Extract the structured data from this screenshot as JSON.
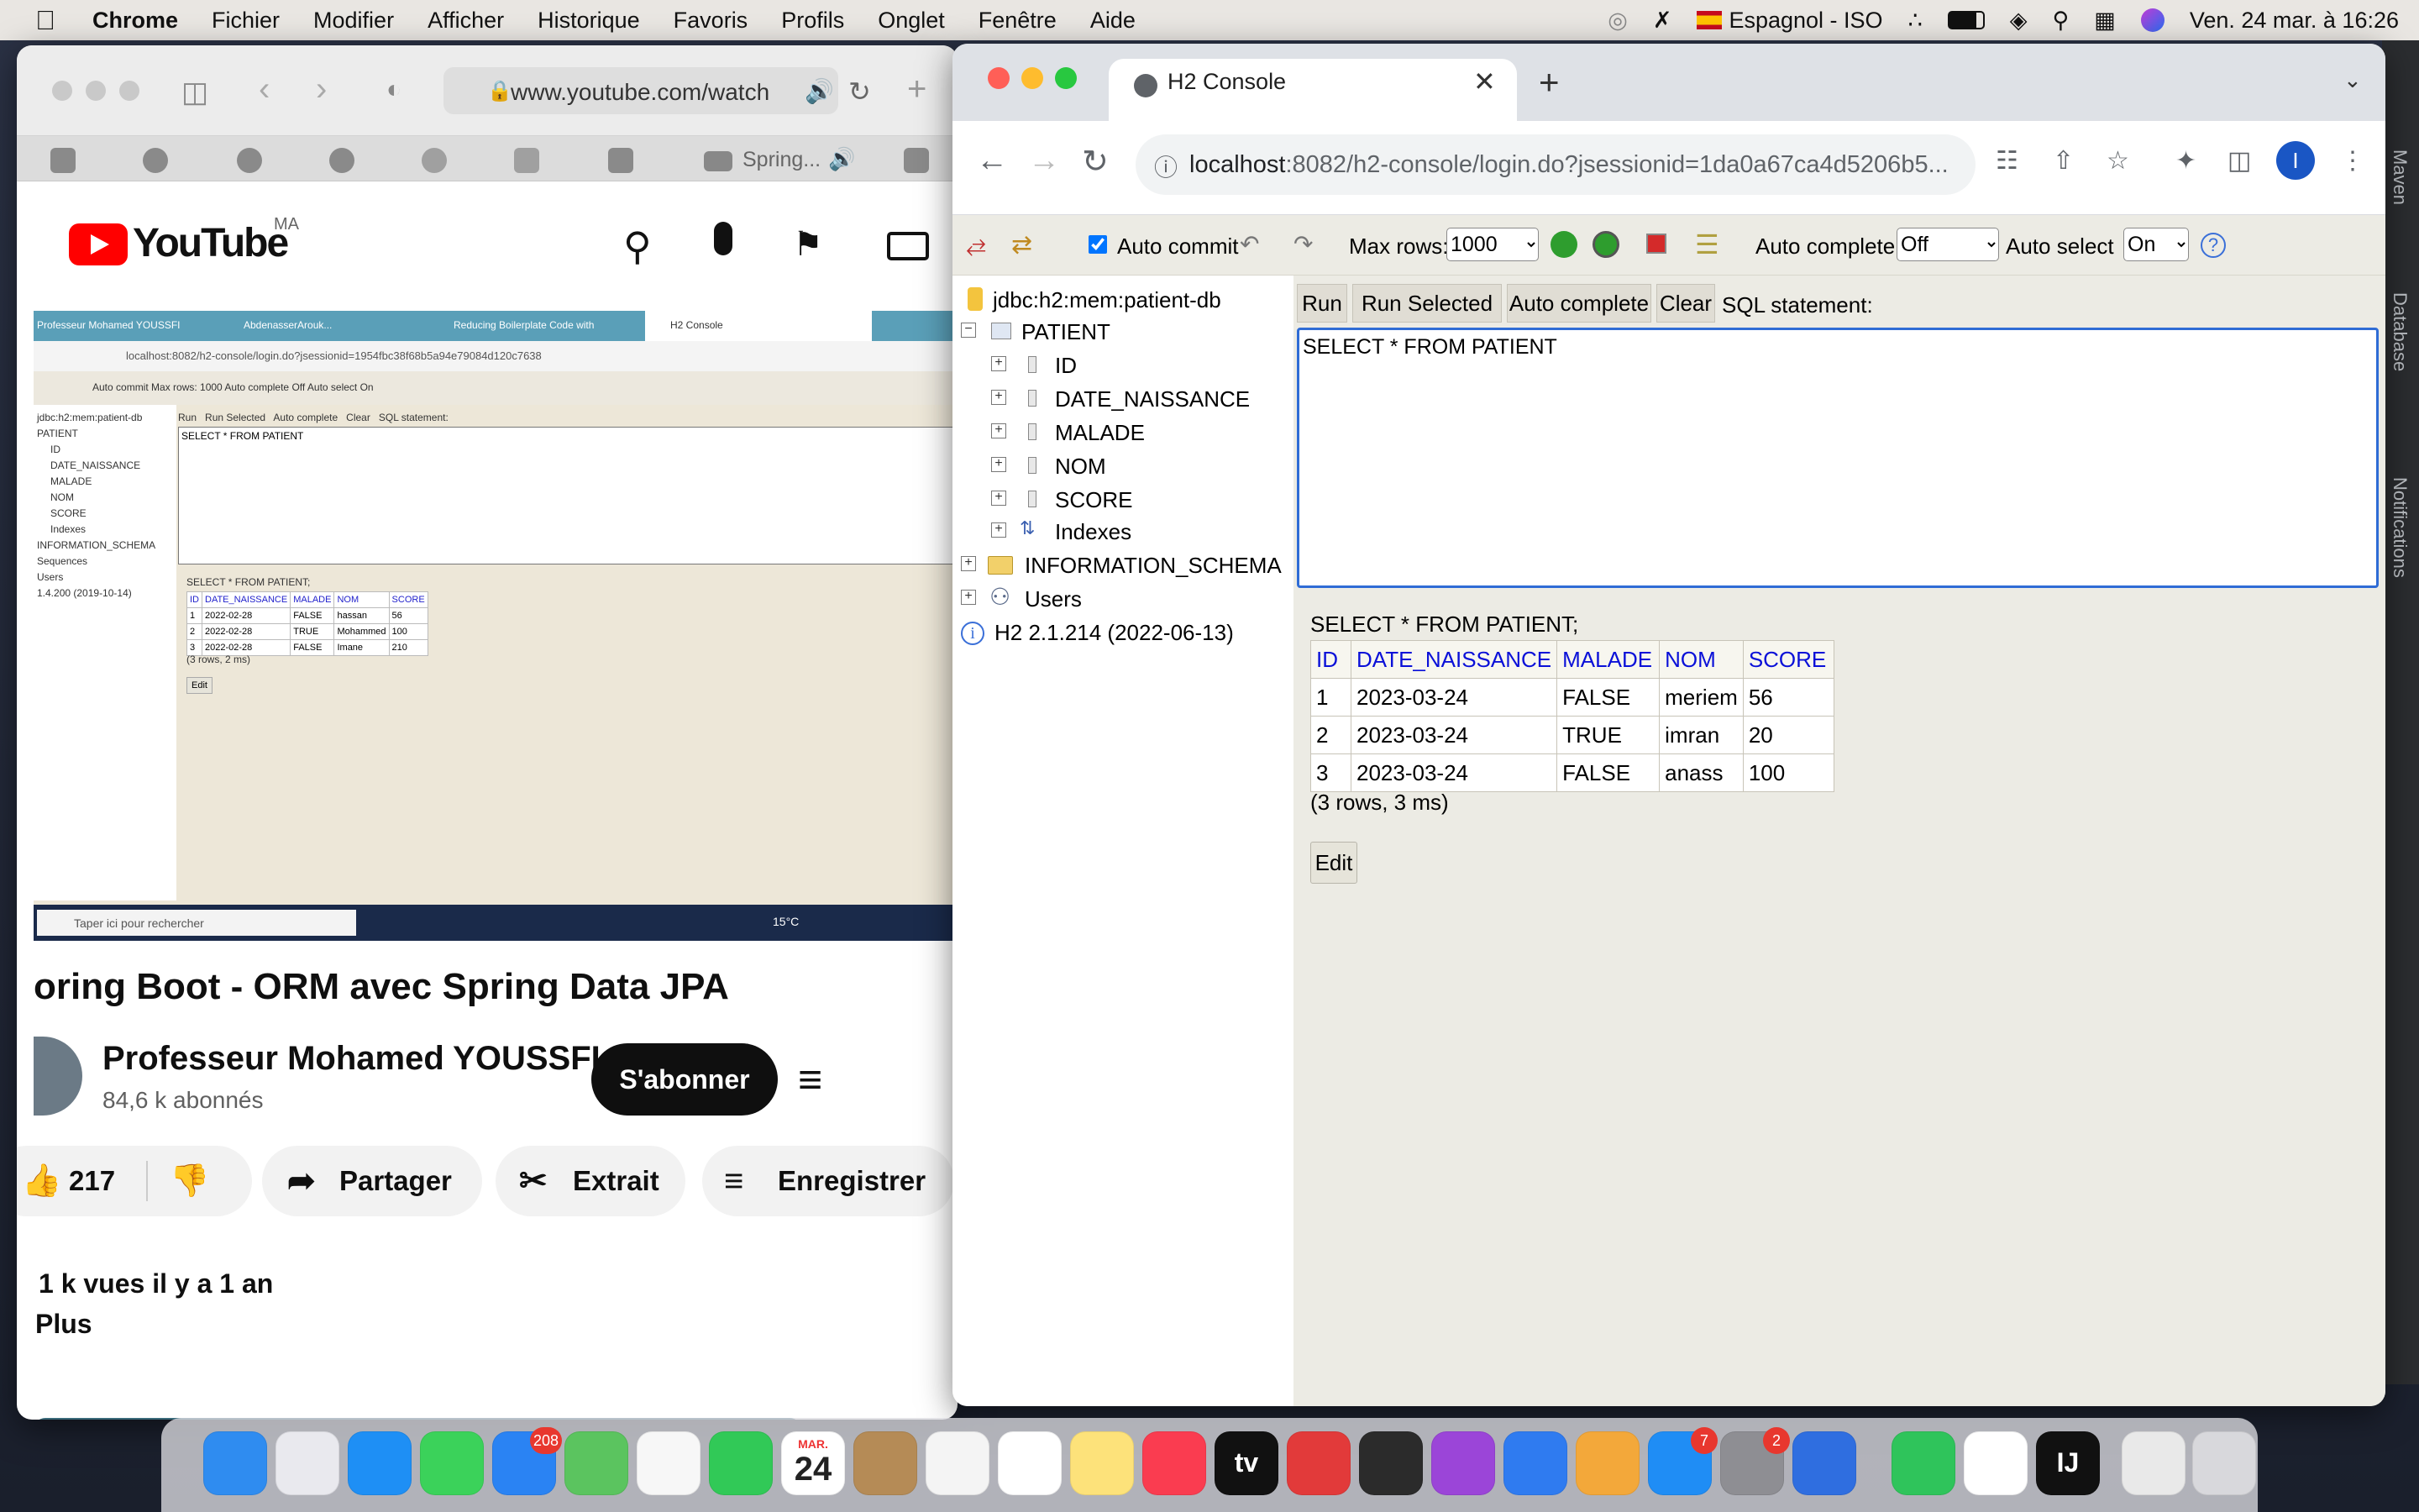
{
  "menubar": {
    "app": "Chrome",
    "items": [
      "Fichier",
      "Modifier",
      "Afficher",
      "Historique",
      "Favoris",
      "Profils",
      "Onglet",
      "Fenêtre",
      "Aide"
    ],
    "input_source": "Espagnol - ISO",
    "datetime": "Ven. 24 mar. à  16:26"
  },
  "right_strip": {
    "items": [
      "Maven",
      "Database",
      "Notifications"
    ]
  },
  "safari": {
    "url": "www.youtube.com/watch",
    "tab_label": "Spring...",
    "youtube_logo": "YouTube",
    "country_code": "MA",
    "embedded": {
      "tabs": [
        "Professeur Mohamed YOUSSFI",
        "AbdenasserArouk...",
        "Reducing Boilerplate Code with",
        "H2 Console"
      ],
      "url": "localhost:8082/h2-console/login.do?jsessionid=1954fbc38f68b5a94e79084d120c7638",
      "toolbar": "Auto commit   Max rows: 1000   Auto complete Off   Auto select On",
      "tree": [
        "jdbc:h2:mem:patient-db",
        "PATIENT",
        "ID",
        "DATE_NAISSANCE",
        "MALADE",
        "NOM",
        "SCORE",
        "Indexes",
        "INFORMATION_SCHEMA",
        "Sequences",
        "Users",
        "1.4.200 (2019-10-14)"
      ],
      "buttons": [
        "Run",
        "Run Selected",
        "Auto complete",
        "Clear",
        "SQL statement:"
      ],
      "sql": "SELECT * FROM PATIENT",
      "result_query": "SELECT * FROM PATIENT;",
      "headers": [
        "ID",
        "DATE_NAISSANCE",
        "MALADE",
        "NOM",
        "SCORE"
      ],
      "rows": [
        [
          "1",
          "2022-02-28",
          "FALSE",
          "hassan",
          "56"
        ],
        [
          "2",
          "2022-02-28",
          "TRUE",
          "Mohammed",
          "100"
        ],
        [
          "3",
          "2022-02-28",
          "FALSE",
          "Imane",
          "210"
        ]
      ],
      "summary": "(3 rows, 2 ms)",
      "edit": "Edit",
      "taskbar_search": "Taper ici pour rechercher",
      "temp": "15°C"
    },
    "video_title": "oring Boot - ORM avec Spring Data JPA",
    "channel": "Professeur Mohamed YOUSSFI",
    "subscribers": "84,6 k abonnés",
    "subscribe": "S'abonner",
    "likes": "217",
    "share": "Partager",
    "clip": "Extrait",
    "save": "Enregistrer",
    "views": "1 k vues  il y a 1 an",
    "more": "Plus"
  },
  "chrome": {
    "tab_title": "H2 Console",
    "url_host": "localhost",
    "url_rest": ":8082/h2-console/login.do?jsessionid=1da0a67ca4d5206b5...",
    "profile": "I"
  },
  "h2": {
    "toolbar": {
      "auto_commit": "Auto commit",
      "max_rows_label": "Max rows:",
      "max_rows_value": "1000",
      "auto_complete_label": "Auto complete",
      "auto_complete_value": "Off",
      "auto_select_label": "Auto select",
      "auto_select_value": "On",
      "help": "?"
    },
    "tree": {
      "db": "jdbc:h2:mem:patient-db",
      "table": "PATIENT",
      "columns": [
        "ID",
        "DATE_NAISSANCE",
        "MALADE",
        "NOM",
        "SCORE"
      ],
      "indexes": "Indexes",
      "schema": "INFORMATION_SCHEMA",
      "users": "Users",
      "version": "H2 2.1.214 (2022-06-13)"
    },
    "buttons": {
      "run": "Run",
      "run_selected": "Run Selected",
      "auto_complete": "Auto complete",
      "clear": "Clear",
      "sql_label": "SQL statement:"
    },
    "sql": "SELECT * FROM PATIENT",
    "result": {
      "query": "SELECT * FROM PATIENT;",
      "headers": [
        "ID",
        "DATE_NAISSANCE",
        "MALADE",
        "NOM",
        "SCORE"
      ],
      "rows": [
        [
          "1",
          "2023-03-24",
          "FALSE",
          "meriem",
          "56"
        ],
        [
          "2",
          "2023-03-24",
          "TRUE",
          "imran",
          "20"
        ],
        [
          "3",
          "2023-03-24",
          "FALSE",
          "anass",
          "100"
        ]
      ],
      "summary": "(3 rows, 3 ms)",
      "edit": "Edit"
    }
  },
  "dock": {
    "apps": [
      {
        "name": "Finder",
        "color": "#2f8cf0"
      },
      {
        "name": "Launchpad",
        "color": "#e9e9ee"
      },
      {
        "name": "Safari",
        "color": "#1e8ff5"
      },
      {
        "name": "Messages",
        "color": "#3bd25a"
      },
      {
        "name": "Mail",
        "color": "#2a83f3",
        "badge": "208"
      },
      {
        "name": "Maps",
        "color": "#5bc45f"
      },
      {
        "name": "Photos",
        "color": "#f7f7f7"
      },
      {
        "name": "FaceTime",
        "color": "#31c957"
      },
      {
        "name": "Calendar",
        "color": "#ffffff",
        "text": "24",
        "month": "MAR."
      },
      {
        "name": "Contacts",
        "color": "#b58b56"
      },
      {
        "name": "Numbers",
        "color": "#f4f4f4"
      },
      {
        "name": "Reminders",
        "color": "#ffffff"
      },
      {
        "name": "Notes",
        "color": "#fde27a"
      },
      {
        "name": "Music",
        "color": "#fa3c50"
      },
      {
        "name": "Apple TV",
        "color": "#111111",
        "text": "tv"
      },
      {
        "name": "Photo Booth",
        "color": "#e23a3a"
      },
      {
        "name": "Calculator",
        "color": "#2b2b2b"
      },
      {
        "name": "Podcasts",
        "color": "#9b45d8"
      },
      {
        "name": "Keynote",
        "color": "#2f7bf0"
      },
      {
        "name": "Pages",
        "color": "#f3a83a"
      },
      {
        "name": "App Store",
        "color": "#1f8df5",
        "badge": "7"
      },
      {
        "name": "System Settings",
        "color": "#8e8e93",
        "badge": "2"
      },
      {
        "name": "Xcode",
        "color": "#2f6ee0"
      },
      {
        "name": "WhatsApp",
        "color": "#2fc45b"
      },
      {
        "name": "Chrome",
        "color": "#ffffff"
      },
      {
        "name": "IntelliJ IDEA",
        "color": "#111111",
        "text": "IJ"
      },
      {
        "name": "Preview",
        "color": "#e9e9e9"
      },
      {
        "name": "Trash",
        "color": "#d8d8dc"
      }
    ]
  }
}
